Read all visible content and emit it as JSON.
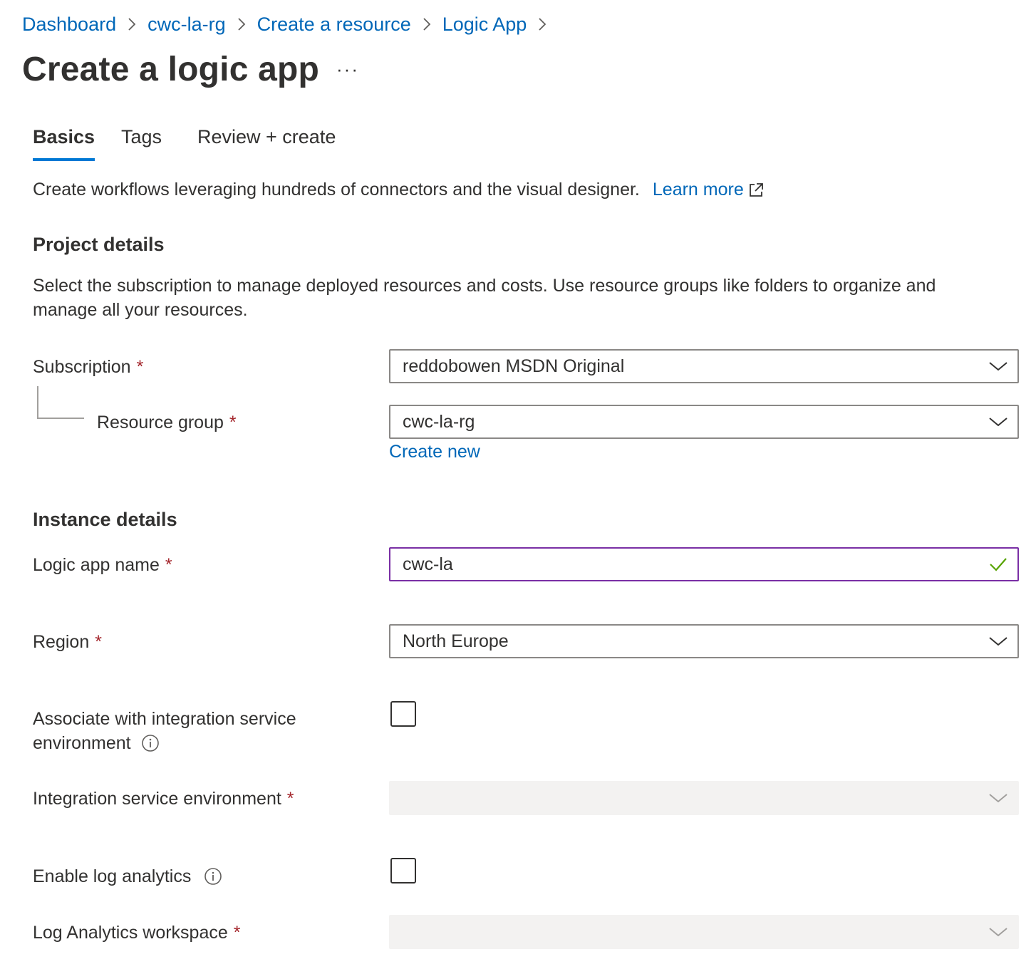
{
  "breadcrumb": {
    "items": [
      {
        "label": "Dashboard"
      },
      {
        "label": "cwc-la-rg"
      },
      {
        "label": "Create a resource"
      },
      {
        "label": "Logic App"
      }
    ]
  },
  "header": {
    "title": "Create a logic app",
    "more_label": "···"
  },
  "tabs": [
    {
      "label": "Basics",
      "active": true
    },
    {
      "label": "Tags",
      "active": false
    },
    {
      "label": "Review + create",
      "active": false
    }
  ],
  "intro": {
    "text": "Create workflows leveraging hundreds of connectors and the visual designer.",
    "learn_more": "Learn more"
  },
  "project_details": {
    "title": "Project details",
    "description": "Select the subscription to manage deployed resources and costs. Use resource groups like folders to organize and manage all your resources.",
    "subscription": {
      "label": "Subscription",
      "value": "reddobowen MSDN Original"
    },
    "resource_group": {
      "label": "Resource group",
      "value": "cwc-la-rg",
      "create_new": "Create new"
    }
  },
  "instance_details": {
    "title": "Instance details",
    "logic_app_name": {
      "label": "Logic app name",
      "value": "cwc-la"
    },
    "region": {
      "label": "Region",
      "value": "North Europe"
    },
    "associate_ise": {
      "label_line1": "Associate with integration service",
      "label_line2": "environment",
      "checked": false
    },
    "ise": {
      "label": "Integration service environment",
      "value": ""
    },
    "log_analytics": {
      "label": "Enable log analytics",
      "checked": false
    },
    "log_workspace": {
      "label": "Log Analytics workspace",
      "value": ""
    }
  },
  "required_marker": "*",
  "colors": {
    "link": "#0067b8",
    "accent": "#0078d4",
    "required": "#a4262c",
    "valid_check": "#57a300",
    "focus_border": "#7a2fa5",
    "disabled_bg": "#f3f2f1"
  }
}
